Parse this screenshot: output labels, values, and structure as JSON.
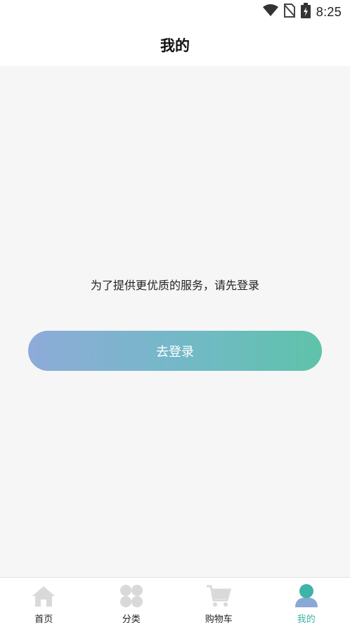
{
  "status_bar": {
    "time": "8:25"
  },
  "header": {
    "title": "我的"
  },
  "main": {
    "prompt": "为了提供更优质的服务，请先登录",
    "login_button": "去登录"
  },
  "tabbar": {
    "items": [
      {
        "label": "首页",
        "icon": "home-icon"
      },
      {
        "label": "分类",
        "icon": "category-icon"
      },
      {
        "label": "购物车",
        "icon": "cart-icon"
      },
      {
        "label": "我的",
        "icon": "profile-icon",
        "active": true
      }
    ]
  },
  "colors": {
    "accent": "#3fb3a8",
    "button_gradient_start": "#8eabd9",
    "button_gradient_end": "#5ec3a9",
    "inactive_icon": "#d9d9d9"
  }
}
